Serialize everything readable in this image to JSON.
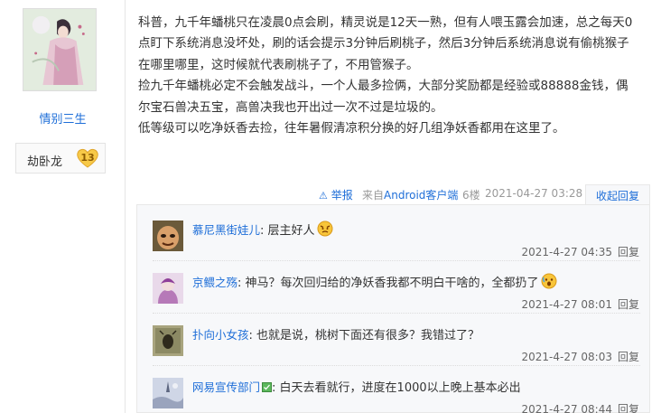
{
  "author": {
    "name": "情别三生",
    "title": "劫卧龙",
    "level": "13"
  },
  "post": {
    "paragraphs": [
      "科普，九千年蟠桃只在凌晨0点会刷，精灵说是12天一熟，但有人喂玉露会加速，总之每天0",
      "点盯下系统消息没坏处，刷的话会提示3分钟后刷桃子，然后3分钟后系统消息说有偷桃猴子",
      "在哪里哪里，这时候就代表刷桃子了，不用管猴子。",
      "捡九千年蟠桃必定不会触发战斗，一个人最多捡俩，大部分奖励都是经验或88888金钱，偶",
      "尔宝石兽决五宝，高兽决我也开出过一次不过是垃圾的。",
      "低等级可以吃净妖香去捡，往年暑假清凉积分换的好几组净妖香都用在这里了。"
    ]
  },
  "footer": {
    "report_label": "举报",
    "source_prefix": "来自",
    "source_link": "Android客户端",
    "floor": "6楼",
    "time": "2021-04-27 03:28",
    "collapse_label": "收起回复"
  },
  "replies": [
    {
      "user": "慕尼黑街娃儿",
      "separator": ":",
      "text": "层主好人",
      "emoji": "angry-face-emoji",
      "time": "2021-4-27 04:35",
      "reply_label": "回复"
    },
    {
      "user": "京鳂之殇",
      "separator": ":",
      "text": "神马？每次回归给的净妖香我都不明白干啥的，全都扔了",
      "emoji": "shocked-face-emoji",
      "time": "2021-4-27 08:01",
      "reply_label": "回复"
    },
    {
      "user": "扑向小女孩",
      "separator": ":",
      "text": "也就是说，桃树下面还有很多？我错过了？",
      "time": "2021-4-27 08:03",
      "reply_label": "回复"
    },
    {
      "user": "网易宣传部门",
      "separator": ":",
      "text": "白天去看就行，进度在1000以上晚上基本必出",
      "vip_icon": "vip-badge-icon",
      "time": "2021-4-27 08:44",
      "reply_label": "回复"
    }
  ],
  "colors": {
    "link": "#1e6ed8",
    "reply_bg": "#f7f8fa"
  }
}
